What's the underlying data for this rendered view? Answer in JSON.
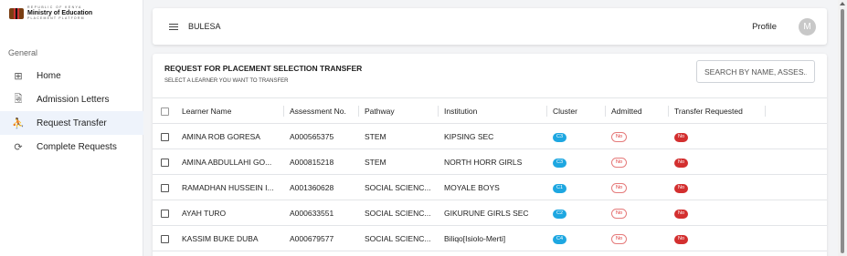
{
  "sidebar": {
    "logo": {
      "top": "REPUBLIC OF KENYA",
      "main": "Ministry of Education",
      "sub": "PLACEMENT PLATFORM"
    },
    "section_label": "General",
    "items": [
      {
        "label": "Home",
        "icon": "⊞"
      },
      {
        "label": "Admission Letters",
        "icon": "🗟"
      },
      {
        "label": "Request Transfer",
        "icon": "⛹"
      },
      {
        "label": "Complete Requests",
        "icon": "⟳"
      }
    ]
  },
  "header": {
    "brand": "BULESA",
    "profile_label": "Profile",
    "avatar_initial": "M"
  },
  "main": {
    "title": "REQUEST FOR PLACEMENT SELECTION TRANSFER",
    "subtitle": "SELECT A LEARNER YOU WANT TO TRANSFER",
    "search_placeholder": "SEARCH BY NAME, ASSES...",
    "columns": [
      "Learner Name",
      "Assessment No.",
      "Pathway",
      "Institution",
      "Cluster",
      "Admitted",
      "Transfer Requested"
    ],
    "rows": [
      {
        "name": "AMINA ROB GORESA",
        "assessment": "A000565375",
        "pathway": "STEM",
        "institution": "KIPSING SEC",
        "cluster": "C3",
        "admitted": "No",
        "transfer": "No"
      },
      {
        "name": "AMINA ABDULLAHI GO...",
        "assessment": "A000815218",
        "pathway": "STEM",
        "institution": "NORTH HORR GIRLS",
        "cluster": "C3",
        "admitted": "No",
        "transfer": "No"
      },
      {
        "name": "RAMADHAN HUSSEIN I...",
        "assessment": "A001360628",
        "pathway": "SOCIAL SCIENC...",
        "institution": "MOYALE BOYS",
        "cluster": "C1",
        "admitted": "No",
        "transfer": "No"
      },
      {
        "name": "AYAH TURO",
        "assessment": "A000633551",
        "pathway": "SOCIAL SCIENC...",
        "institution": "GIKURUNE GIRLS SEC",
        "cluster": "C2",
        "admitted": "No",
        "transfer": "No"
      },
      {
        "name": "KASSIM BUKE DUBA",
        "assessment": "A000679577",
        "pathway": "SOCIAL SCIENC...",
        "institution": "Biliqo[Isiolo-Merti]",
        "cluster": "C4",
        "admitted": "No",
        "transfer": "No"
      }
    ]
  },
  "colors": {
    "cluster_badge": "#1ea7e1",
    "admitted_no": "#d33333",
    "transfer_no": "#d32f2f",
    "active_nav_bg": "#eef3fb"
  }
}
